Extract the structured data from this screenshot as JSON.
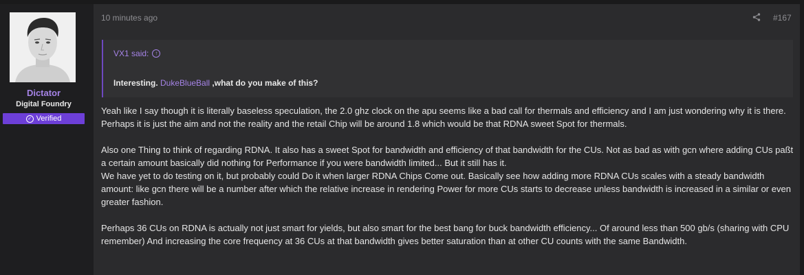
{
  "user": {
    "name": "Dictator",
    "title": "Digital Foundry",
    "badge": "Verified"
  },
  "post": {
    "time": "10 minutes ago",
    "number": "#167",
    "quote": {
      "author_label": "VX1 said:",
      "text_bold": "Interesting. ",
      "mention": "DukeBlueBall",
      "text_after": " ,what do you make of this?"
    },
    "paragraphs": [
      "Yeah like I say though it is literally baseless speculation, the 2.0 ghz clock on the apu seems like a bad call for thermals and efficiency and I am just wondering why it is there. Perhaps it is just the aim and not the reality and the retail Chip will be around 1.8 which would be that RDNA sweet Spot for thermals.",
      "Also one Thing to think of regarding RDNA. It also has a sweet Spot for bandwidth and efficiency of that bandwidth for the CUs. Not as bad as with gcn where adding CUs paßt a certain amount basically did nothing for Performance if you were bandwidth limited... But it still has it.",
      "We have yet to do testing on it, but probably could Do it when larger RDNA Chips Come out. Basically see how adding more RDNA CUs scales with a steady bandwidth amount: like gcn there will be a number after which the relative increase in rendering Power for more CUs starts to decrease unless bandwidth is increased in a similar or even greater fashion.",
      "Perhaps 36 CUs on RDNA is actually not just smart for yields, but also smart for the best bang for buck bandwidth efficiency... Of around less than 500 gb/s (sharing with CPU remember) And increasing the core frequency at 36 CUs at that bandwidth gives better saturation than at other CU counts with the same Bandwidth."
    ]
  },
  "colors": {
    "accent": "#a583e6",
    "badge": "#6d3fd8",
    "post_bg": "#2b2b2d",
    "page_bg": "#1a1a1b"
  },
  "icons": {
    "share": "share-icon",
    "verified": "check-circle-icon",
    "quote_jump": "arrow-up-circle-icon"
  }
}
